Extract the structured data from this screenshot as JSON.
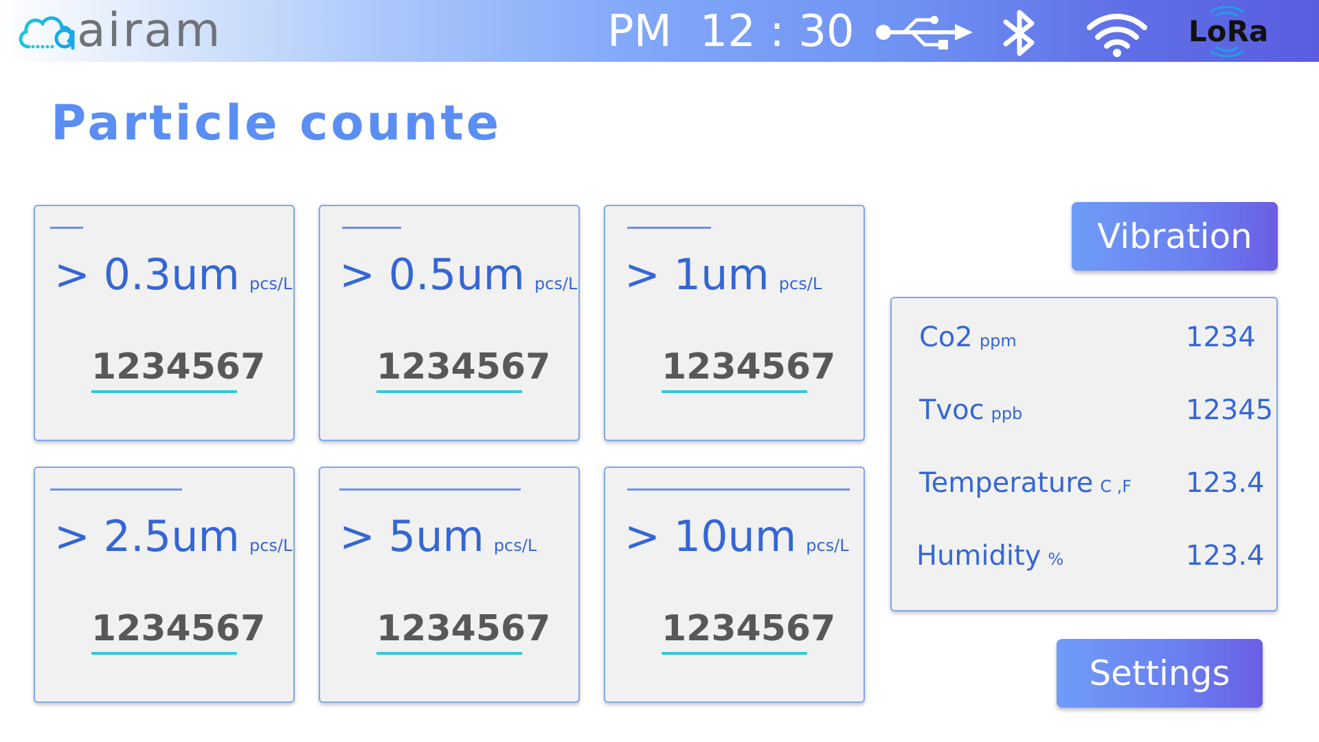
{
  "header": {
    "logo_text": "airam",
    "clock": "PM  12 : 30",
    "icons": [
      "usb-icon",
      "bluetooth-icon",
      "wifi-icon",
      "lora-icon"
    ],
    "lora_label": "LoRa"
  },
  "page_title": "Particle counte",
  "particle_cards": [
    {
      "size": "> 0.3um",
      "unit": "pcs/L",
      "value": "1234567"
    },
    {
      "size": "> 0.5um",
      "unit": "pcs/L",
      "value": "1234567"
    },
    {
      "size": "> 1um",
      "unit": "pcs/L",
      "value": "1234567"
    },
    {
      "size": "> 2.5um",
      "unit": "pcs/L",
      "value": "1234567"
    },
    {
      "size": "> 5um",
      "unit": "pcs/L",
      "value": "1234567"
    },
    {
      "size": "> 10um",
      "unit": "pcs/L",
      "value": "1234567"
    }
  ],
  "buttons": {
    "vibration": "Vibration",
    "settings": "Settings"
  },
  "sensors": [
    {
      "label": "Co2",
      "unit": "ppm",
      "value": "1234"
    },
    {
      "label": "Tvoc",
      "unit": "ppb",
      "value": "12345"
    },
    {
      "label": "Temperature",
      "unit": "C ,F",
      "value": "123.4"
    },
    {
      "label": "Humidity",
      "unit": "%",
      "value": "123.4"
    }
  ],
  "colors": {
    "accent_blue": "#3566d4",
    "title_blue": "#5a8ef5",
    "underline_cyan": "#2ec9d9",
    "card_bg": "#f1f1f1"
  }
}
